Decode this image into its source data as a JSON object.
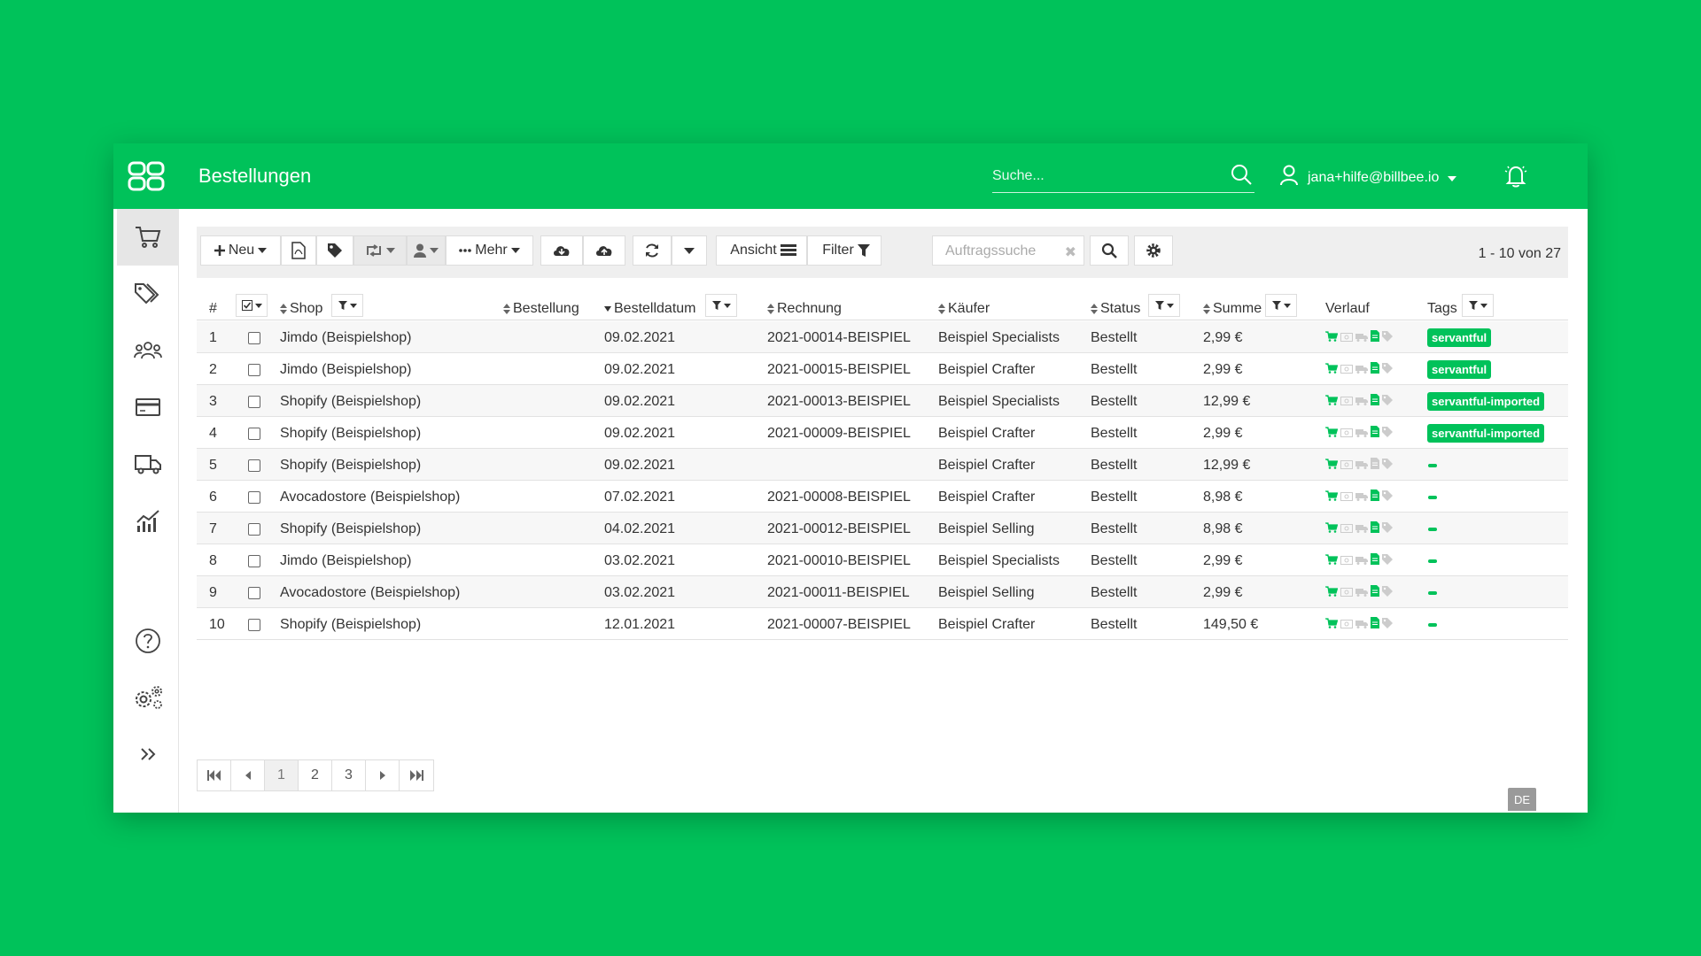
{
  "header": {
    "title": "Bestellungen",
    "search_placeholder": "Suche...",
    "user_email": "jana+hilfe@billbee.io"
  },
  "sidebar": {
    "items": [
      "cart-icon",
      "tags-icon",
      "customers-icon",
      "payments-icon",
      "shipping-icon",
      "statistics-icon",
      "help-icon",
      "settings-icon",
      "expand-icon"
    ],
    "active": "cart-icon"
  },
  "toolbar": {
    "new_label": "Neu",
    "more_label": "Mehr",
    "view_label": "Ansicht",
    "filter_label": "Filter",
    "search_placeholder": "Auftragssuche",
    "range_text": "1 - 10 von 27"
  },
  "table": {
    "headers": {
      "num": "#",
      "shop": "Shop",
      "order": "Bestellung",
      "date": "Bestelldatum",
      "invoice": "Rechnung",
      "buyer": "Käufer",
      "status": "Status",
      "sum": "Summe",
      "history": "Verlauf",
      "tags": "Tags"
    },
    "rows": [
      {
        "num": "1",
        "shop": "Jimdo (Beispielshop)",
        "date": "09.02.2021",
        "invoice": "2021-00014-BEISPIEL",
        "buyer": "Beispiel Specialists",
        "status": "Bestellt",
        "sum": "2,99 €",
        "tag": "servantful"
      },
      {
        "num": "2",
        "shop": "Jimdo (Beispielshop)",
        "date": "09.02.2021",
        "invoice": "2021-00015-BEISPIEL",
        "buyer": "Beispiel Crafter",
        "status": "Bestellt",
        "sum": "2,99 €",
        "tag": "servantful"
      },
      {
        "num": "3",
        "shop": "Shopify (Beispielshop)",
        "date": "09.02.2021",
        "invoice": "2021-00013-BEISPIEL",
        "buyer": "Beispiel Specialists",
        "status": "Bestellt",
        "sum": "12,99 €",
        "tag": "servantful-imported"
      },
      {
        "num": "4",
        "shop": "Shopify (Beispielshop)",
        "date": "09.02.2021",
        "invoice": "2021-00009-BEISPIEL",
        "buyer": "Beispiel Crafter",
        "status": "Bestellt",
        "sum": "2,99 €",
        "tag": "servantful-imported"
      },
      {
        "num": "5",
        "shop": "Shopify (Beispielshop)",
        "date": "09.02.2021",
        "invoice": "",
        "buyer": "Beispiel Crafter",
        "status": "Bestellt",
        "sum": "12,99 €",
        "tag": ""
      },
      {
        "num": "6",
        "shop": "Avocadostore (Beispielshop)",
        "date": "07.02.2021",
        "invoice": "2021-00008-BEISPIEL",
        "buyer": "Beispiel Crafter",
        "status": "Bestellt",
        "sum": "8,98 €",
        "tag": ""
      },
      {
        "num": "7",
        "shop": "Shopify (Beispielshop)",
        "date": "04.02.2021",
        "invoice": "2021-00012-BEISPIEL",
        "buyer": "Beispiel Selling",
        "status": "Bestellt",
        "sum": "8,98 €",
        "tag": ""
      },
      {
        "num": "8",
        "shop": "Jimdo (Beispielshop)",
        "date": "03.02.2021",
        "invoice": "2021-00010-BEISPIEL",
        "buyer": "Beispiel Specialists",
        "status": "Bestellt",
        "sum": "2,99 €",
        "tag": ""
      },
      {
        "num": "9",
        "shop": "Avocadostore (Beispielshop)",
        "date": "03.02.2021",
        "invoice": "2021-00011-BEISPIEL",
        "buyer": "Beispiel Selling",
        "status": "Bestellt",
        "sum": "2,99 €",
        "tag": ""
      },
      {
        "num": "10",
        "shop": "Shopify (Beispielshop)",
        "date": "12.01.2021",
        "invoice": "2021-00007-BEISPIEL",
        "buyer": "Beispiel Crafter",
        "status": "Bestellt",
        "sum": "149,50 €",
        "tag": ""
      }
    ]
  },
  "pager": {
    "pages": [
      "1",
      "2",
      "3"
    ],
    "active": "1"
  },
  "lang": "DE",
  "colors": {
    "brand": "#00c25a",
    "muted_icon": "#cccccc"
  }
}
